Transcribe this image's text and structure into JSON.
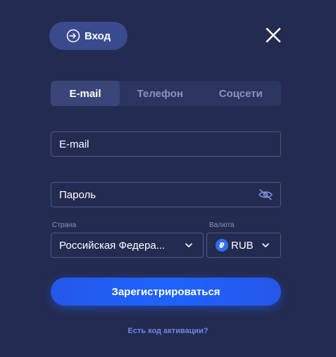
{
  "header": {
    "login_label": "Вход"
  },
  "tabs": [
    {
      "label": "E-mail",
      "active": true
    },
    {
      "label": "Телефон",
      "active": false
    },
    {
      "label": "Соцсети",
      "active": false
    }
  ],
  "form": {
    "email_placeholder": "E-mail",
    "password_placeholder": "Пароль",
    "country_label": "Страна",
    "country_value": "Российская Федера...",
    "currency_label": "Валюта",
    "currency_value": "RUB",
    "currency_symbol": "₽"
  },
  "actions": {
    "register_label": "Зарегистрироваться",
    "activation_link": "Есть код активации?"
  },
  "colors": {
    "background": "#242b50",
    "accent": "#1e63ff",
    "link": "#6f86e8"
  }
}
